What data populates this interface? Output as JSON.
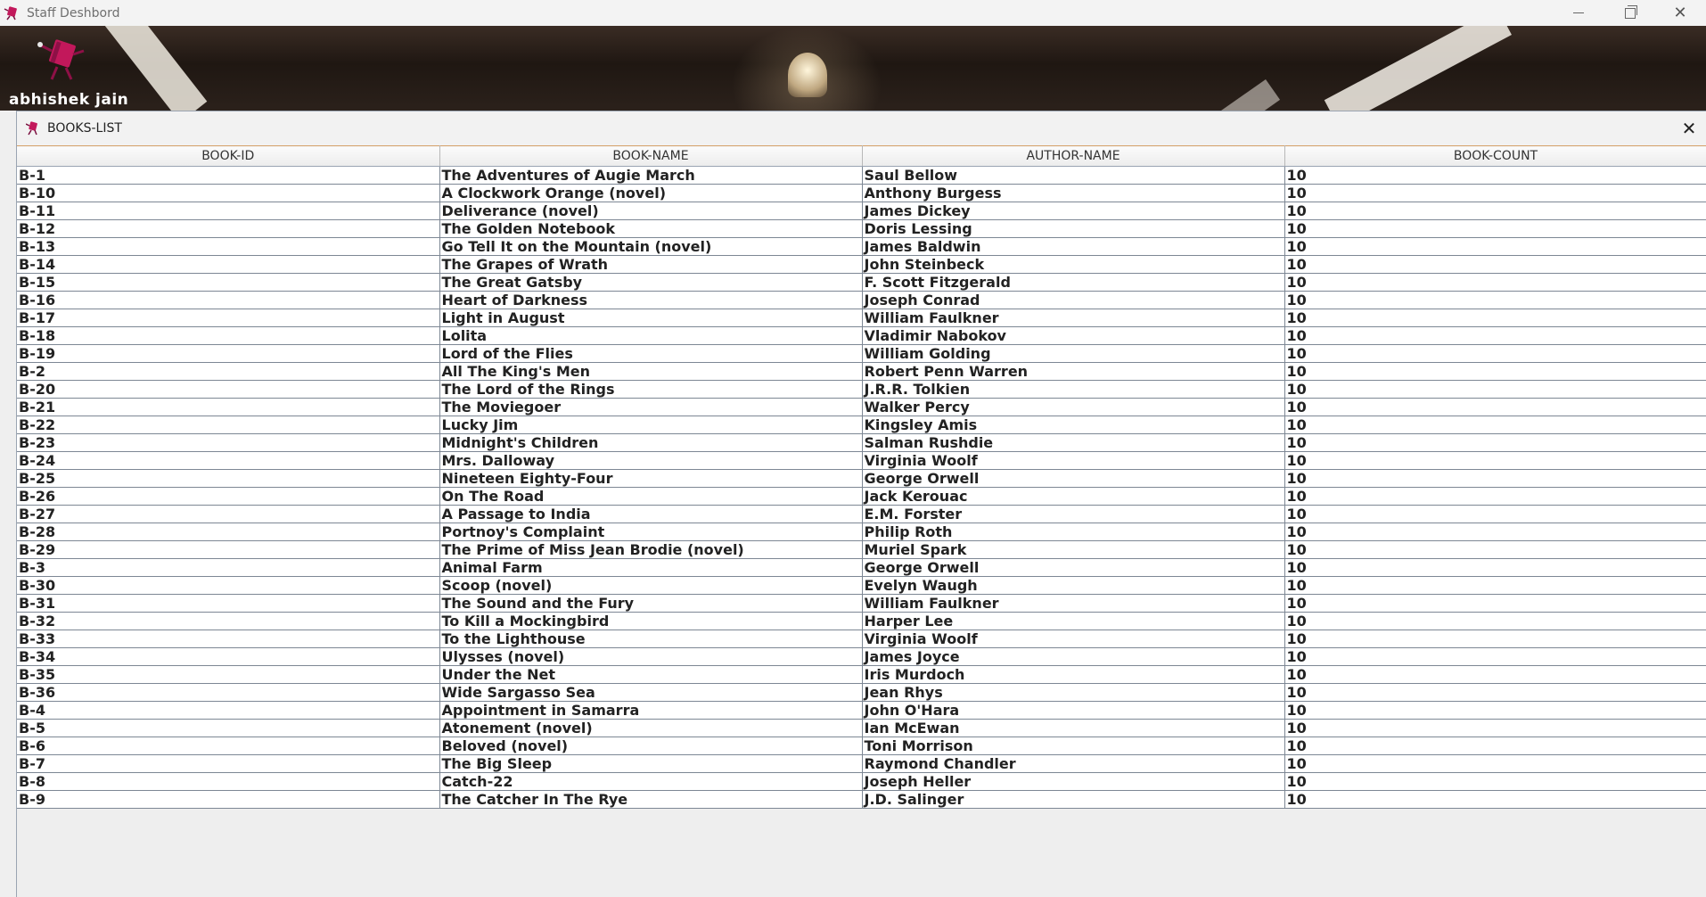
{
  "window": {
    "title": "Staff Deshbord"
  },
  "banner": {
    "username": "abhishek jain"
  },
  "frame": {
    "title": "BOOKS-LIST"
  },
  "table": {
    "columns": [
      "BOOK-ID",
      "BOOK-NAME",
      "AUTHOR-NAME",
      "BOOK-COUNT"
    ],
    "rows": [
      [
        "B-1",
        "The Adventures of Augie March",
        "Saul Bellow",
        "10"
      ],
      [
        "B-10",
        "A Clockwork Orange (novel)",
        "Anthony Burgess",
        "10"
      ],
      [
        "B-11",
        "Deliverance (novel)",
        "James Dickey",
        "10"
      ],
      [
        "B-12",
        "The Golden Notebook",
        "Doris Lessing",
        "10"
      ],
      [
        "B-13",
        "Go Tell It on the Mountain (novel)",
        "James Baldwin",
        "10"
      ],
      [
        "B-14",
        "The Grapes of Wrath",
        "John Steinbeck",
        "10"
      ],
      [
        "B-15",
        "The Great Gatsby",
        "F. Scott Fitzgerald",
        "10"
      ],
      [
        "B-16",
        "Heart of Darkness",
        "Joseph Conrad",
        "10"
      ],
      [
        "B-17",
        "Light in August",
        "William Faulkner",
        "10"
      ],
      [
        "B-18",
        "Lolita",
        "Vladimir Nabokov",
        "10"
      ],
      [
        "B-19",
        "Lord of the Flies",
        "William Golding",
        "10"
      ],
      [
        "B-2",
        "All The King's Men",
        "Robert Penn Warren",
        "10"
      ],
      [
        "B-20",
        "The Lord of the Rings",
        "J.R.R. Tolkien",
        "10"
      ],
      [
        "B-21",
        "The Moviegoer",
        "Walker Percy",
        "10"
      ],
      [
        "B-22",
        "Lucky Jim",
        "Kingsley Amis",
        "10"
      ],
      [
        "B-23",
        "Midnight's Children",
        "Salman Rushdie",
        "10"
      ],
      [
        "B-24",
        "Mrs. Dalloway",
        "Virginia Woolf",
        "10"
      ],
      [
        "B-25",
        "Nineteen Eighty-Four",
        "George Orwell",
        "10"
      ],
      [
        "B-26",
        "On The Road",
        "Jack Kerouac",
        "10"
      ],
      [
        "B-27",
        "A Passage to India",
        "E.M. Forster",
        "10"
      ],
      [
        "B-28",
        "Portnoy's Complaint",
        "Philip Roth",
        "10"
      ],
      [
        "B-29",
        "The Prime of Miss Jean Brodie (novel)",
        "Muriel Spark",
        "10"
      ],
      [
        "B-3",
        "Animal Farm",
        "George Orwell",
        "10"
      ],
      [
        "B-30",
        "Scoop (novel)",
        "Evelyn Waugh",
        "10"
      ],
      [
        "B-31",
        "The Sound and the Fury",
        "William Faulkner",
        "10"
      ],
      [
        "B-32",
        "To Kill a Mockingbird",
        "Harper Lee",
        "10"
      ],
      [
        "B-33",
        "To the Lighthouse",
        "Virginia Woolf",
        "10"
      ],
      [
        "B-34",
        "Ulysses (novel)",
        "James Joyce",
        "10"
      ],
      [
        "B-35",
        "Under the Net",
        "Iris Murdoch",
        "10"
      ],
      [
        "B-36",
        "Wide Sargasso Sea",
        "Jean Rhys",
        "10"
      ],
      [
        "B-4",
        "Appointment in Samarra",
        "John O'Hara",
        "10"
      ],
      [
        "B-5",
        "Atonement (novel)",
        "Ian McEwan",
        "10"
      ],
      [
        "B-6",
        "Beloved (novel)",
        "Toni Morrison",
        "10"
      ],
      [
        "B-7",
        "The Big Sleep",
        "Raymond Chandler",
        "10"
      ],
      [
        "B-8",
        "Catch-22",
        "Joseph Heller",
        "10"
      ],
      [
        "B-9",
        "The Catcher In The Rye",
        "J.D. Salinger",
        "10"
      ]
    ]
  },
  "icons": {
    "app": "book-mascot-icon",
    "avatar": "book-mascot-icon",
    "frame": "book-mascot-icon",
    "minimize": "minimize-icon",
    "maximize": "restore-icon",
    "close": "close-icon"
  },
  "colors": {
    "mascot": "#c2185b",
    "frame_border": "#9aa4b2",
    "header_accent": "#d6a36b"
  }
}
